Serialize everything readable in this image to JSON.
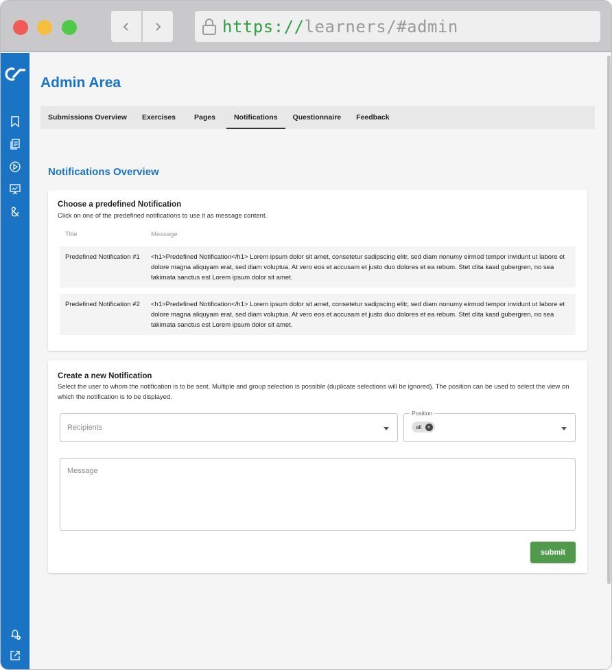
{
  "browser": {
    "url_scheme": "https://",
    "url_rest": "learners/#admin"
  },
  "header": {
    "title": "Admin Area"
  },
  "tabs": [
    {
      "label": "Submissions Overview",
      "active": false
    },
    {
      "label": "Exercises",
      "active": false
    },
    {
      "label": "Pages",
      "active": false
    },
    {
      "label": "Notifications",
      "active": true
    },
    {
      "label": "Questionnaire",
      "active": false
    },
    {
      "label": "Feedback",
      "active": false
    }
  ],
  "section": {
    "title": "Notifications Overview"
  },
  "predefined": {
    "title": "Choose a predefined Notification",
    "description": "Click on one of the predefined notifications to use it as message content.",
    "columns": {
      "title": "Title",
      "message": "Message"
    },
    "rows": [
      {
        "title": "Predefined Notification #1",
        "message": "<h1>Predefined Notification</h1> Lorem ipsum dolor sit amet, consetetur sadipscing elitr, sed diam nonumy eirmod tempor invidunt ut labore et dolore magna aliquyam erat, sed diam voluptua. At vero eos et accusam et justo duo dolores et ea rebum. Stet clita kasd gubergren, no sea takimata sanctus est Lorem ipsum dolor sit amet."
      },
      {
        "title": "Predefined Notification #2",
        "message": "<h1>Predefined Notification</h1> Lorem ipsum dolor sit amet, consetetur sadipscing elitr, sed diam nonumy eirmod tempor invidunt ut labore et dolore magna aliquyam erat, sed diam voluptua. At vero eos et accusam et justo duo dolores et ea rebum. Stet clita kasd gubergren, no sea takimata sanctus est Lorem ipsum dolor sit amet."
      }
    ]
  },
  "create": {
    "title": "Create a new Notification",
    "description": "Select the user to whom the notification is to be sent. Multiple and group selection is possible (duplicate selections will be ignored). The position can be used to select the view on which the notification is to be displayed.",
    "recipients_placeholder": "Recipients",
    "position_label": "Position",
    "position_chip": "all",
    "message_placeholder": "Message",
    "submit_label": "submit"
  },
  "colors": {
    "brand": "#1b73c4",
    "submit": "#4f9a4b"
  },
  "icons": {
    "sidebar_top": [
      "logo-icon",
      "bookmark-icon",
      "documents-icon",
      "play-circle-icon",
      "presentation-icon",
      "ampersand-icon"
    ],
    "sidebar_bottom": [
      "notification-bell-icon",
      "external-link-icon"
    ]
  }
}
